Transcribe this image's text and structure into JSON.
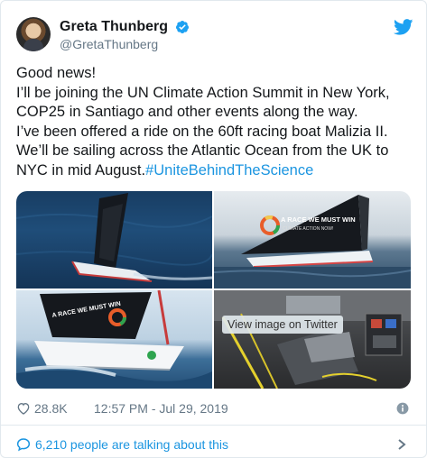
{
  "author": {
    "display_name": "Greta Thunberg",
    "handle": "@GretaThunberg"
  },
  "tweet": {
    "text": "Good news!\nI’ll be joining the UN Climate Action Summit in New York,\nCOP25 in Santiago and other events along the way.\nI’ve been offered a ride on the 60ft racing boat Malizia II.\nWe’ll be sailing across the Atlantic Ocean from the UK to\nNYC in mid August.",
    "hashtag": "#UniteBehindTheScience"
  },
  "media": {
    "overlay_label": "View image on Twitter",
    "sail_text": "A RACE WE MUST WIN",
    "sail_subtext": "CLIMATE ACTION NOW!"
  },
  "meta": {
    "likes": "28.8K",
    "timestamp": "12:57 PM - Jul 29, 2019"
  },
  "conversation": {
    "label": "6,210 people are talking about this"
  },
  "colors": {
    "accent": "#1b95e0",
    "muted": "#657786",
    "twitter_blue": "#1da1f2"
  },
  "icons": [
    "verified-badge-icon",
    "twitter-bird-icon",
    "heart-icon",
    "info-icon",
    "speech-bubble-icon",
    "chevron-right-icon"
  ]
}
